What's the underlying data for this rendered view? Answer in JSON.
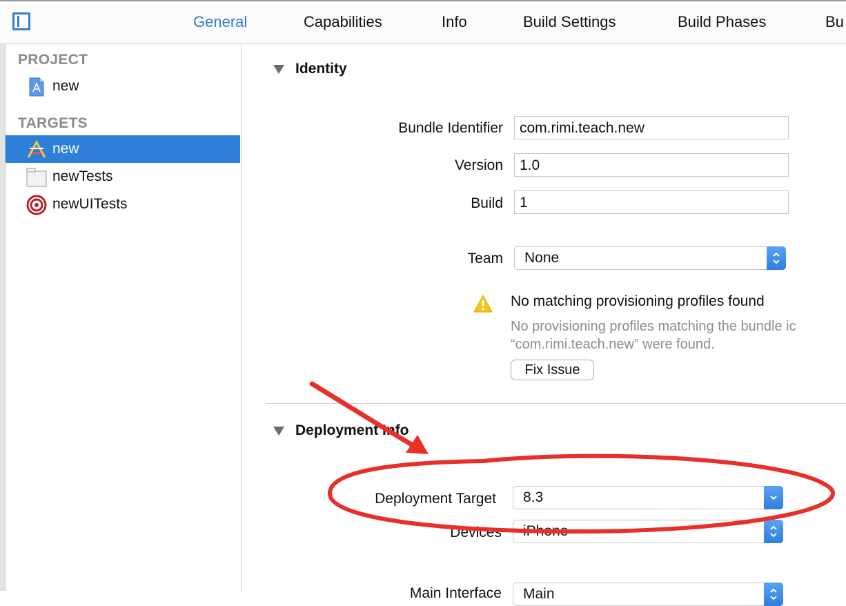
{
  "tabs": {
    "general": "General",
    "capabilities": "Capabilities",
    "info": "Info",
    "build_settings": "Build Settings",
    "build_phases": "Build Phases",
    "build_rules_partial": "Bu"
  },
  "sidebar": {
    "project_header": "PROJECT",
    "project_item": "new",
    "targets_header": "TARGETS",
    "targets": [
      {
        "label": "new",
        "icon": "app-target-icon",
        "selected": true
      },
      {
        "label": "newTests",
        "icon": "test-bundle-icon",
        "selected": false
      },
      {
        "label": "newUITests",
        "icon": "ui-test-target-icon",
        "selected": false
      }
    ]
  },
  "identity": {
    "title": "Identity",
    "bundle_identifier_label": "Bundle Identifier",
    "bundle_identifier_value": "com.rimi.teach.new",
    "version_label": "Version",
    "version_value": "1.0",
    "build_label": "Build",
    "build_value": "1",
    "team_label": "Team",
    "team_value": "None",
    "warning_title": "No matching provisioning profiles found",
    "warning_line1": "No provisioning profiles matching the bundle ic",
    "warning_line2": "“com.rimi.teach.new” were found.",
    "fix_issue_label": "Fix Issue"
  },
  "deployment": {
    "title": "Deployment Info",
    "target_label": "Deployment Target",
    "target_value": "8.3",
    "devices_label": "Devices",
    "devices_value": "iPhone",
    "main_interface_label": "Main Interface",
    "main_interface_value": "Main"
  },
  "colors": {
    "accent": "#2d7ed2",
    "selection": "#2e7fd8",
    "annotation": "#e8302a",
    "warning": "#f5c518"
  }
}
